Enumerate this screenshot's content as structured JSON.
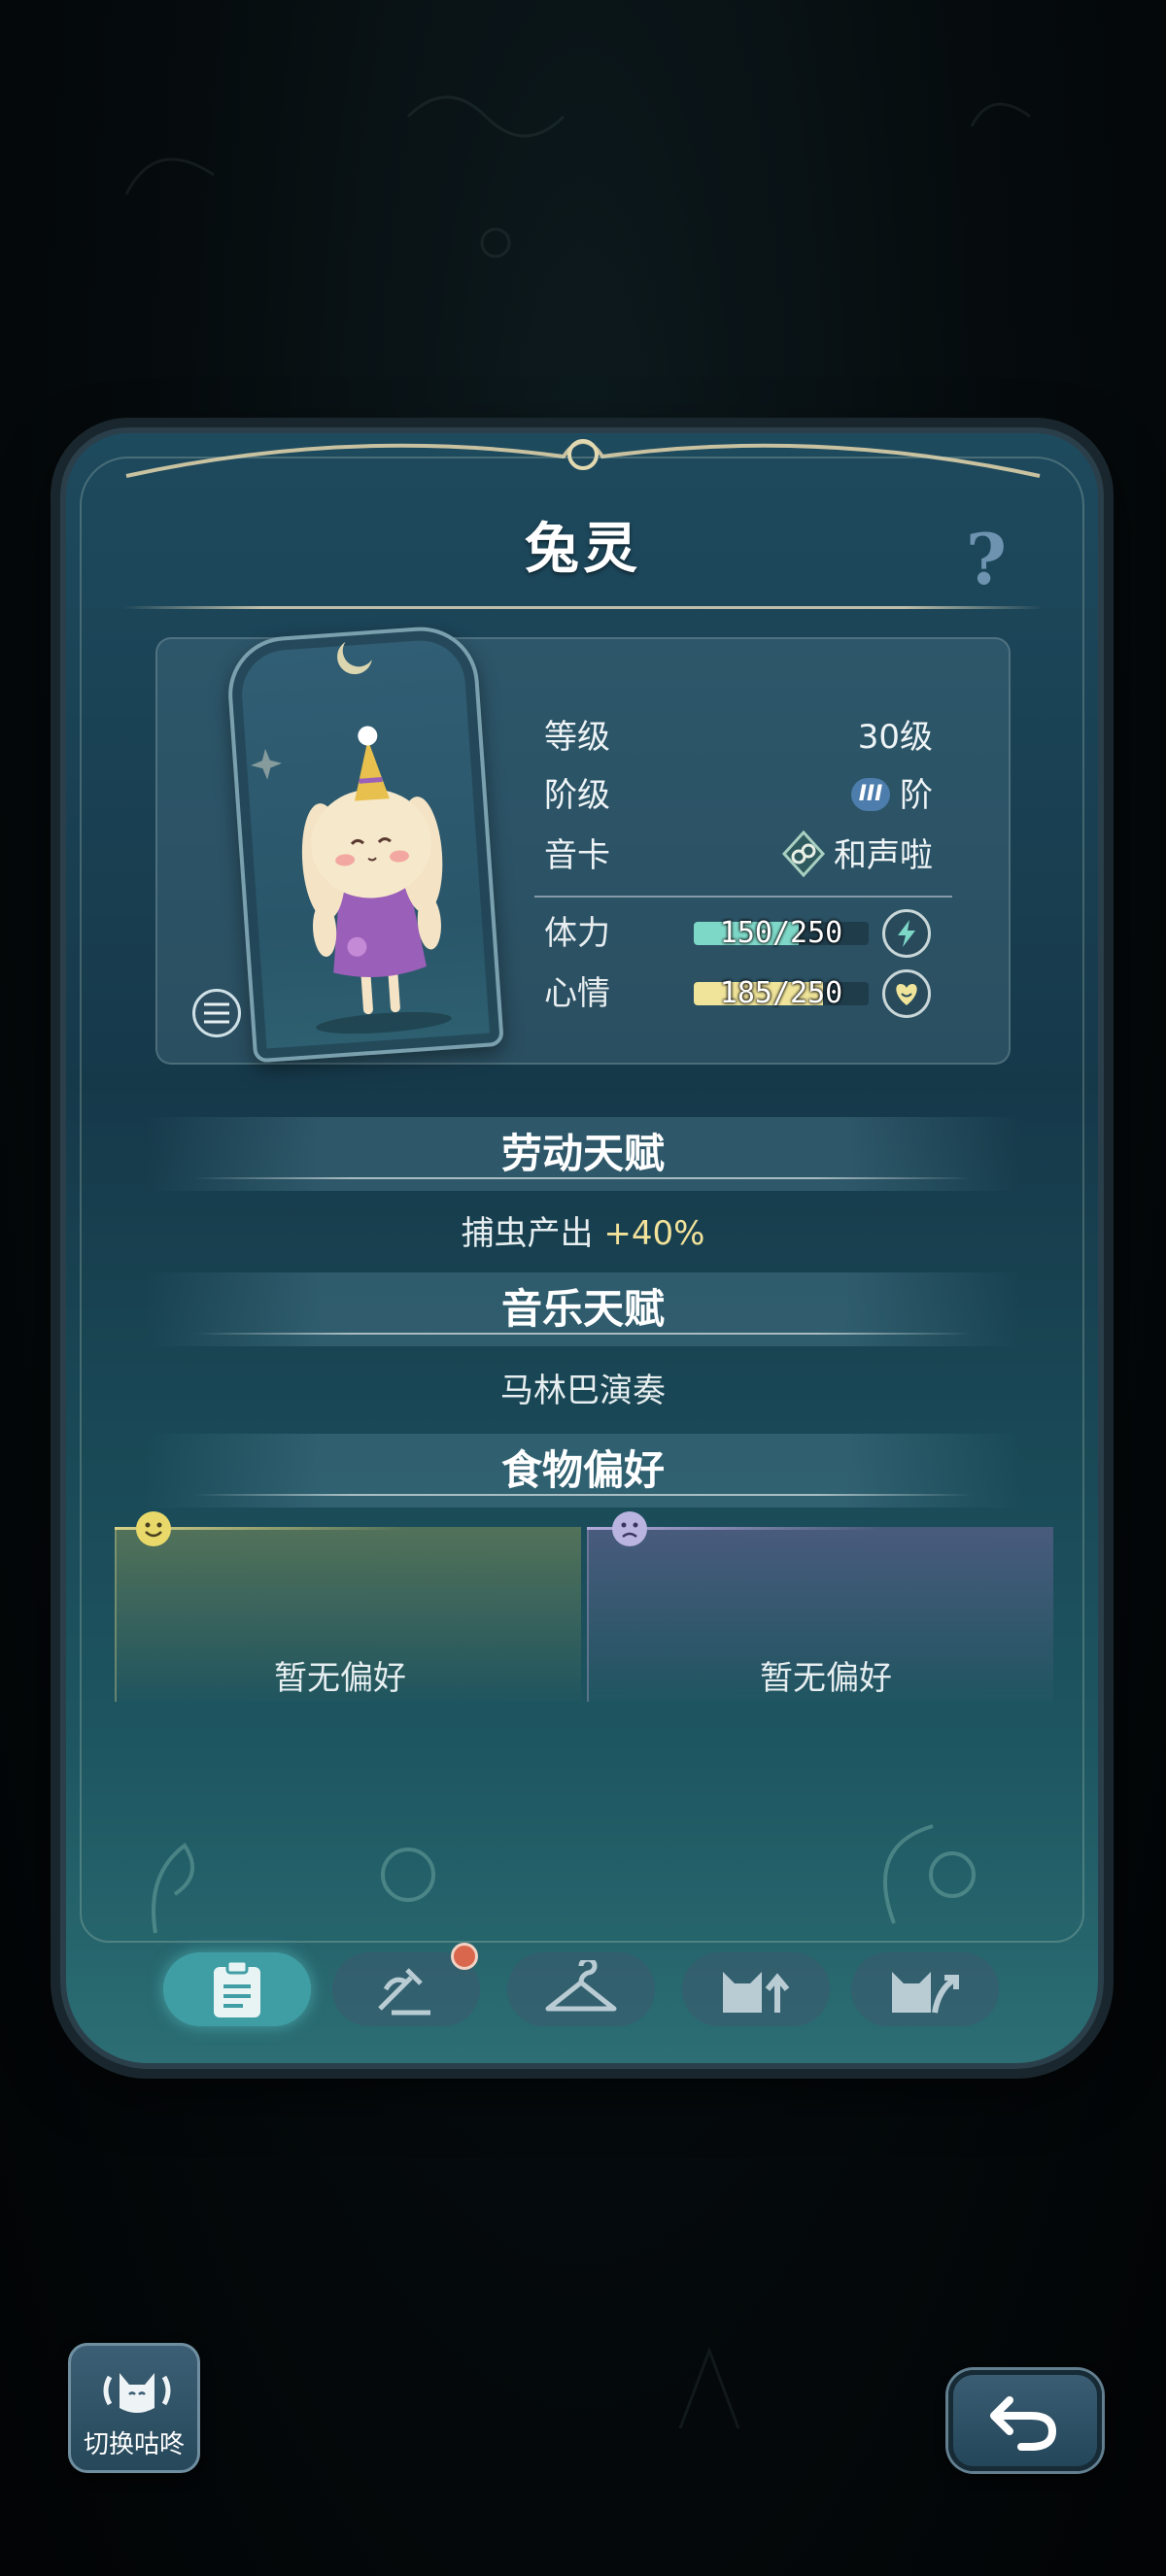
{
  "title": "兔灵",
  "stats": {
    "level_label": "等级",
    "level_value": "30级",
    "stage_label": "阶级",
    "stage_badge": "III",
    "stage_value": "阶",
    "card_label": "音卡",
    "card_value": "和声啦"
  },
  "bars": {
    "stamina_label": "体力",
    "stamina_text": "150/250",
    "stamina_current": 150,
    "stamina_max": 250,
    "stamina_color": "#7ed8c8",
    "mood_label": "心情",
    "mood_text": "185/250",
    "mood_current": 185,
    "mood_max": 250,
    "mood_color": "#f0e49a"
  },
  "labor": {
    "title": "劳动天赋",
    "text_prefix": "捕虫产出 ",
    "text_value": "+40%"
  },
  "music": {
    "title": "音乐天赋",
    "text": "马林巴演奏"
  },
  "food": {
    "title": "食物偏好",
    "like_text": "暂无偏好",
    "dislike_text": "暂无偏好",
    "like_icon": "smile-face-icon",
    "dislike_icon": "sad-face-icon"
  },
  "tabs": [
    {
      "icon": "clipboard-icon",
      "active": true
    },
    {
      "icon": "tools-icon",
      "active": false,
      "notification": true
    },
    {
      "icon": "hanger-icon",
      "active": false
    },
    {
      "icon": "cat-upgrade-icon",
      "active": false
    },
    {
      "icon": "cat-evolve-icon",
      "active": false
    }
  ],
  "switch_button": {
    "label": "切换咕咚",
    "icon": "rabbit-switch-icon"
  },
  "back_button": {
    "icon": "back-arrow-icon"
  }
}
